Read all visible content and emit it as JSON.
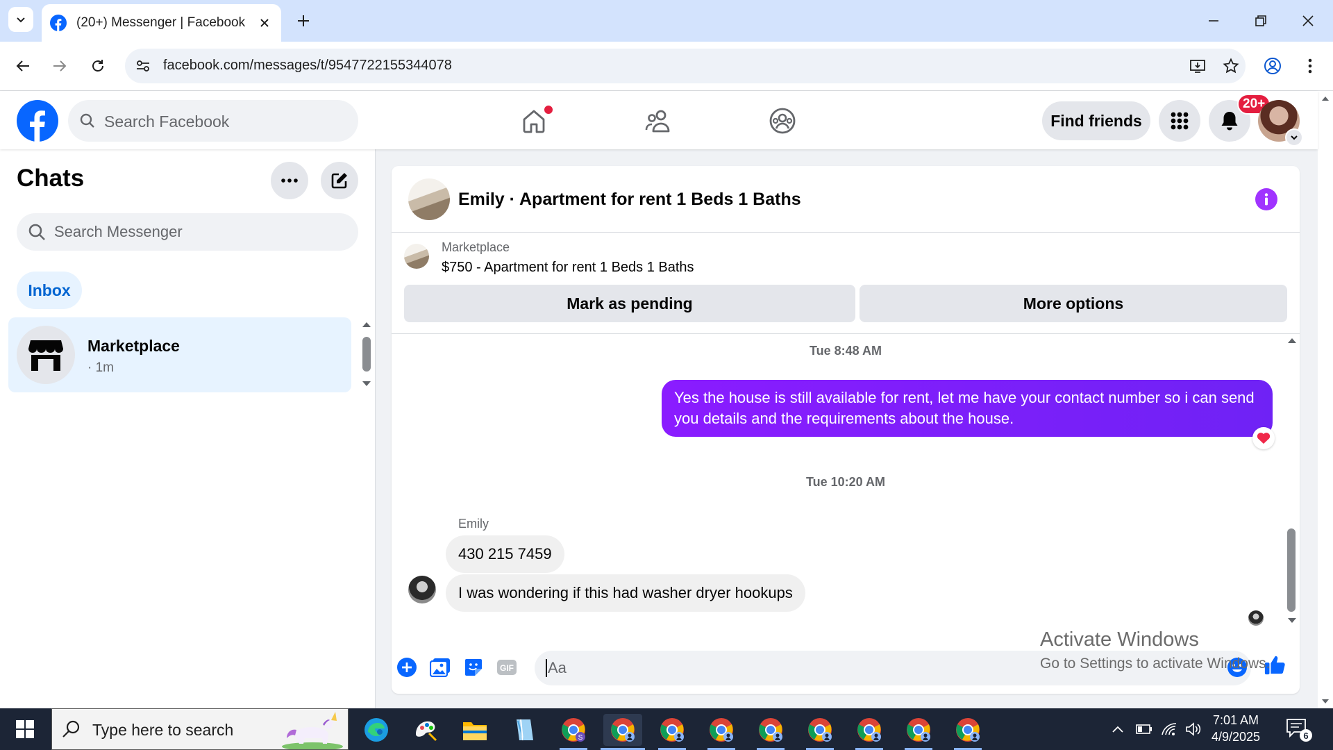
{
  "browser": {
    "tab_title": "(20+) Messenger | Facebook",
    "url": "facebook.com/messages/t/9547722155344078"
  },
  "fb_header": {
    "search_placeholder": "Search Facebook",
    "find_friends_label": "Find friends",
    "notification_badge": "20+"
  },
  "sidebar": {
    "title": "Chats",
    "search_placeholder": "Search Messenger",
    "inbox_label": "Inbox",
    "chats": [
      {
        "name": "Marketplace",
        "time": "· 1m"
      }
    ]
  },
  "conversation": {
    "title": "Emily · Apartment for rent 1 Beds 1 Baths",
    "listing": {
      "label": "Marketplace",
      "price_title": "$750 - Apartment for rent 1 Beds 1 Baths",
      "pending_label": "Mark as pending",
      "more_label": "More options"
    },
    "timestamps": [
      "Tue 8:48 AM",
      "Tue 10:20 AM"
    ],
    "outgoing_message": "Yes the house is still available for rent, let me have your contact number so i can send you details and the requirements about the house.",
    "sender_name": "Emily",
    "incoming_messages": [
      "430 215 7459",
      "I was wondering if this had washer dryer hookups"
    ],
    "composer_placeholder": "Aa"
  },
  "watermark": {
    "line1": "Activate Windows",
    "line2": "Go to Settings to activate Windows."
  },
  "taskbar": {
    "search_placeholder": "Type here to search",
    "time": "7:01 AM",
    "date": "4/9/2025",
    "notification_count": "6"
  },
  "colors": {
    "fb_blue": "#0866ff",
    "messenger_purple": "#7b1fff",
    "badge_red": "#e41e3f",
    "chrome_tabbar": "#d3e3fd",
    "taskbar": "#1c2536"
  }
}
